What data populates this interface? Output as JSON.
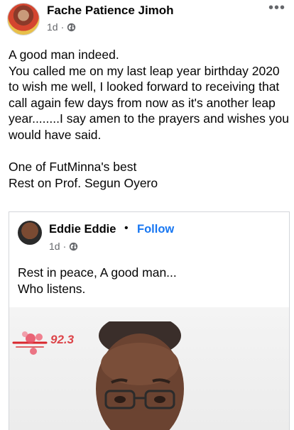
{
  "post": {
    "author": "Fache Patience Jimoh",
    "time": "1d",
    "separator": "·",
    "more_label": "•••",
    "body": "A good man indeed.\nYou called me on my last leap year birthday 2020 to wish me well, I looked forward to receiving that call again few days from now as it's another leap year........I say amen to the prayers and wishes you would have said.\n\nOne of FutMinna's best\nRest on Prof. Segun Oyero"
  },
  "shared": {
    "author": "Eddie Eddie",
    "bullet": "•",
    "follow_label": "Follow",
    "time": "1d",
    "separator": "·",
    "text": "Rest in peace, A good man...\nWho listens.",
    "photo_logo_text": "92.3"
  },
  "colors": {
    "link_blue": "#1877f2",
    "meta_gray": "#65676b",
    "logo_red": "#d9262c"
  },
  "icons": {
    "audience": "globe-icon",
    "more": "more-options-icon"
  }
}
